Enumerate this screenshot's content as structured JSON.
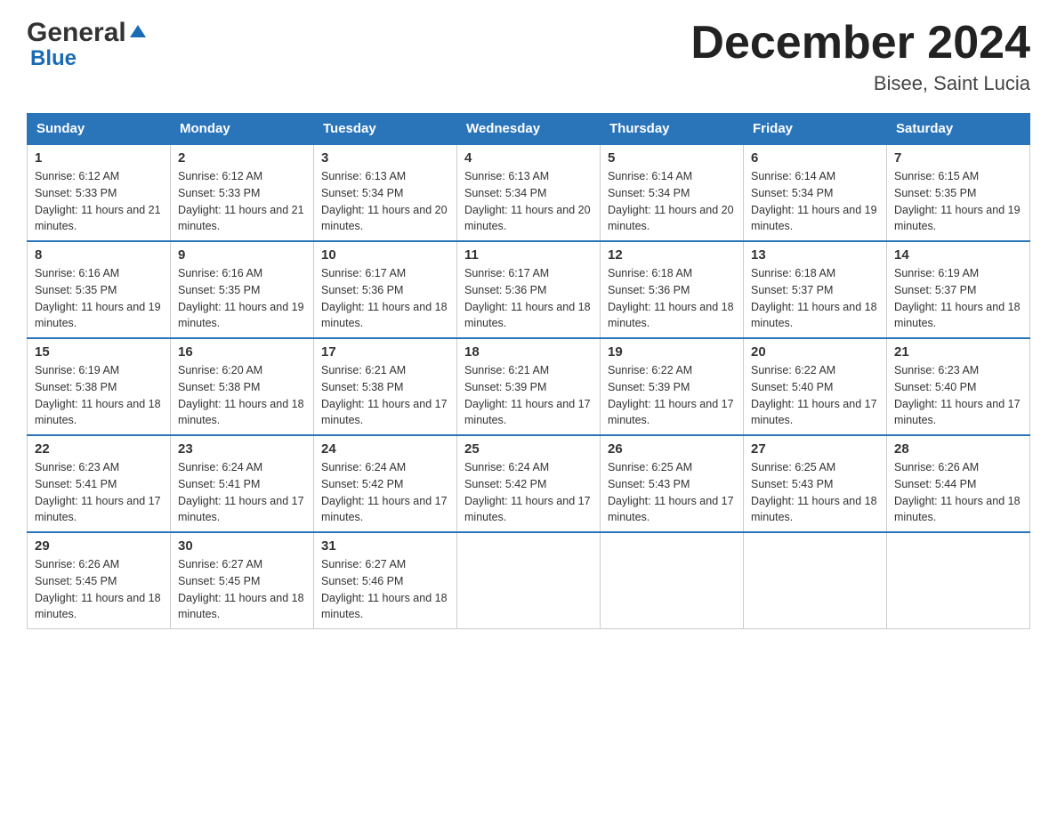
{
  "logo": {
    "name": "General",
    "name2": "Blue"
  },
  "title": "December 2024",
  "subtitle": "Bisee, Saint Lucia",
  "days_of_week": [
    "Sunday",
    "Monday",
    "Tuesday",
    "Wednesday",
    "Thursday",
    "Friday",
    "Saturday"
  ],
  "weeks": [
    [
      {
        "num": "1",
        "sunrise": "6:12 AM",
        "sunset": "5:33 PM",
        "daylight": "11 hours and 21 minutes."
      },
      {
        "num": "2",
        "sunrise": "6:12 AM",
        "sunset": "5:33 PM",
        "daylight": "11 hours and 21 minutes."
      },
      {
        "num": "3",
        "sunrise": "6:13 AM",
        "sunset": "5:34 PM",
        "daylight": "11 hours and 20 minutes."
      },
      {
        "num": "4",
        "sunrise": "6:13 AM",
        "sunset": "5:34 PM",
        "daylight": "11 hours and 20 minutes."
      },
      {
        "num": "5",
        "sunrise": "6:14 AM",
        "sunset": "5:34 PM",
        "daylight": "11 hours and 20 minutes."
      },
      {
        "num": "6",
        "sunrise": "6:14 AM",
        "sunset": "5:34 PM",
        "daylight": "11 hours and 19 minutes."
      },
      {
        "num": "7",
        "sunrise": "6:15 AM",
        "sunset": "5:35 PM",
        "daylight": "11 hours and 19 minutes."
      }
    ],
    [
      {
        "num": "8",
        "sunrise": "6:16 AM",
        "sunset": "5:35 PM",
        "daylight": "11 hours and 19 minutes."
      },
      {
        "num": "9",
        "sunrise": "6:16 AM",
        "sunset": "5:35 PM",
        "daylight": "11 hours and 19 minutes."
      },
      {
        "num": "10",
        "sunrise": "6:17 AM",
        "sunset": "5:36 PM",
        "daylight": "11 hours and 18 minutes."
      },
      {
        "num": "11",
        "sunrise": "6:17 AM",
        "sunset": "5:36 PM",
        "daylight": "11 hours and 18 minutes."
      },
      {
        "num": "12",
        "sunrise": "6:18 AM",
        "sunset": "5:36 PM",
        "daylight": "11 hours and 18 minutes."
      },
      {
        "num": "13",
        "sunrise": "6:18 AM",
        "sunset": "5:37 PM",
        "daylight": "11 hours and 18 minutes."
      },
      {
        "num": "14",
        "sunrise": "6:19 AM",
        "sunset": "5:37 PM",
        "daylight": "11 hours and 18 minutes."
      }
    ],
    [
      {
        "num": "15",
        "sunrise": "6:19 AM",
        "sunset": "5:38 PM",
        "daylight": "11 hours and 18 minutes."
      },
      {
        "num": "16",
        "sunrise": "6:20 AM",
        "sunset": "5:38 PM",
        "daylight": "11 hours and 18 minutes."
      },
      {
        "num": "17",
        "sunrise": "6:21 AM",
        "sunset": "5:38 PM",
        "daylight": "11 hours and 17 minutes."
      },
      {
        "num": "18",
        "sunrise": "6:21 AM",
        "sunset": "5:39 PM",
        "daylight": "11 hours and 17 minutes."
      },
      {
        "num": "19",
        "sunrise": "6:22 AM",
        "sunset": "5:39 PM",
        "daylight": "11 hours and 17 minutes."
      },
      {
        "num": "20",
        "sunrise": "6:22 AM",
        "sunset": "5:40 PM",
        "daylight": "11 hours and 17 minutes."
      },
      {
        "num": "21",
        "sunrise": "6:23 AM",
        "sunset": "5:40 PM",
        "daylight": "11 hours and 17 minutes."
      }
    ],
    [
      {
        "num": "22",
        "sunrise": "6:23 AM",
        "sunset": "5:41 PM",
        "daylight": "11 hours and 17 minutes."
      },
      {
        "num": "23",
        "sunrise": "6:24 AM",
        "sunset": "5:41 PM",
        "daylight": "11 hours and 17 minutes."
      },
      {
        "num": "24",
        "sunrise": "6:24 AM",
        "sunset": "5:42 PM",
        "daylight": "11 hours and 17 minutes."
      },
      {
        "num": "25",
        "sunrise": "6:24 AM",
        "sunset": "5:42 PM",
        "daylight": "11 hours and 17 minutes."
      },
      {
        "num": "26",
        "sunrise": "6:25 AM",
        "sunset": "5:43 PM",
        "daylight": "11 hours and 17 minutes."
      },
      {
        "num": "27",
        "sunrise": "6:25 AM",
        "sunset": "5:43 PM",
        "daylight": "11 hours and 18 minutes."
      },
      {
        "num": "28",
        "sunrise": "6:26 AM",
        "sunset": "5:44 PM",
        "daylight": "11 hours and 18 minutes."
      }
    ],
    [
      {
        "num": "29",
        "sunrise": "6:26 AM",
        "sunset": "5:45 PM",
        "daylight": "11 hours and 18 minutes."
      },
      {
        "num": "30",
        "sunrise": "6:27 AM",
        "sunset": "5:45 PM",
        "daylight": "11 hours and 18 minutes."
      },
      {
        "num": "31",
        "sunrise": "6:27 AM",
        "sunset": "5:46 PM",
        "daylight": "11 hours and 18 minutes."
      },
      null,
      null,
      null,
      null
    ]
  ]
}
